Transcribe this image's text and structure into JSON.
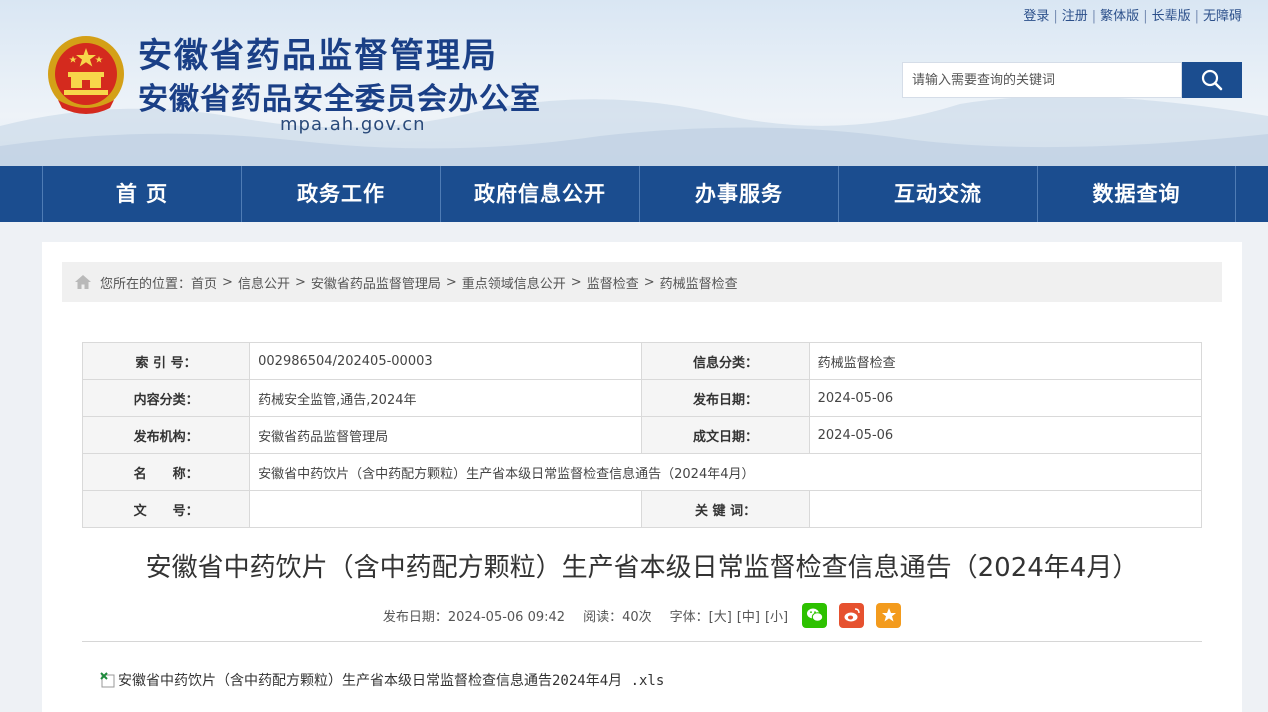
{
  "header": {
    "title": "安徽省药品监督管理局",
    "subtitle": "安徽省药品安全委员会办公室",
    "domain": "mpa.ah.gov.cn",
    "toplinks": [
      "登录",
      "注册",
      "繁体版",
      "长辈版",
      "无障碍"
    ],
    "search_placeholder": "请输入需要查询的关键词"
  },
  "nav": {
    "items": [
      "首 页",
      "政务工作",
      "政府信息公开",
      "办事服务",
      "互动交流",
      "数据查询"
    ]
  },
  "breadcrumb": {
    "prefix": "您所在的位置：",
    "items": [
      "首页",
      "信息公开",
      "安徽省药品监督管理局",
      "重点领域信息公开",
      "监督检查",
      "药械监督检查"
    ]
  },
  "meta_table": {
    "index_label": "索 引 号：",
    "index_value": "002986504/202405-00003",
    "info_category_label": "信息分类：",
    "info_category_value": "药械监督检查",
    "content_category_label": "内容分类：",
    "content_category_value": "药械安全监管,通告,2024年",
    "publish_date_label": "发布日期：",
    "publish_date_value": "2024-05-06",
    "publisher_label": "发布机构：",
    "publisher_value": "安徽省药品监督管理局",
    "created_date_label": "成文日期：",
    "created_date_value": "2024-05-06",
    "name_label": "名　　称：",
    "name_value": "安徽省中药饮片（含中药配方颗粒）生产省本级日常监督检查信息通告（2024年4月）",
    "doc_no_label": "文　　号：",
    "doc_no_value": "",
    "keywords_label": "关 键 词：",
    "keywords_value": ""
  },
  "article": {
    "title": "安徽省中药饮片（含中药配方颗粒）生产省本级日常监督检查信息通告（2024年4月）",
    "publish_info": "发布日期：2024-05-06 09:42",
    "reads": "阅读：40次",
    "font_label": "字体：",
    "font_large": "[大]",
    "font_medium": "[中]",
    "font_small": "[小]",
    "attachment": "安徽省中药饮片（含中药配方颗粒）生产省本级日常监督检查信息通告2024年4月 .xls"
  },
  "colors": {
    "primary": "#1b4d8f",
    "title_blue": "#1a3f86",
    "wechat": "#2dc100",
    "weibo": "#e6512f",
    "favorite": "#f39b1d"
  },
  "icons": [
    "national-emblem-icon",
    "search-icon",
    "home-icon",
    "wechat-icon",
    "weibo-icon",
    "favorite-icon",
    "xls-file-icon"
  ]
}
